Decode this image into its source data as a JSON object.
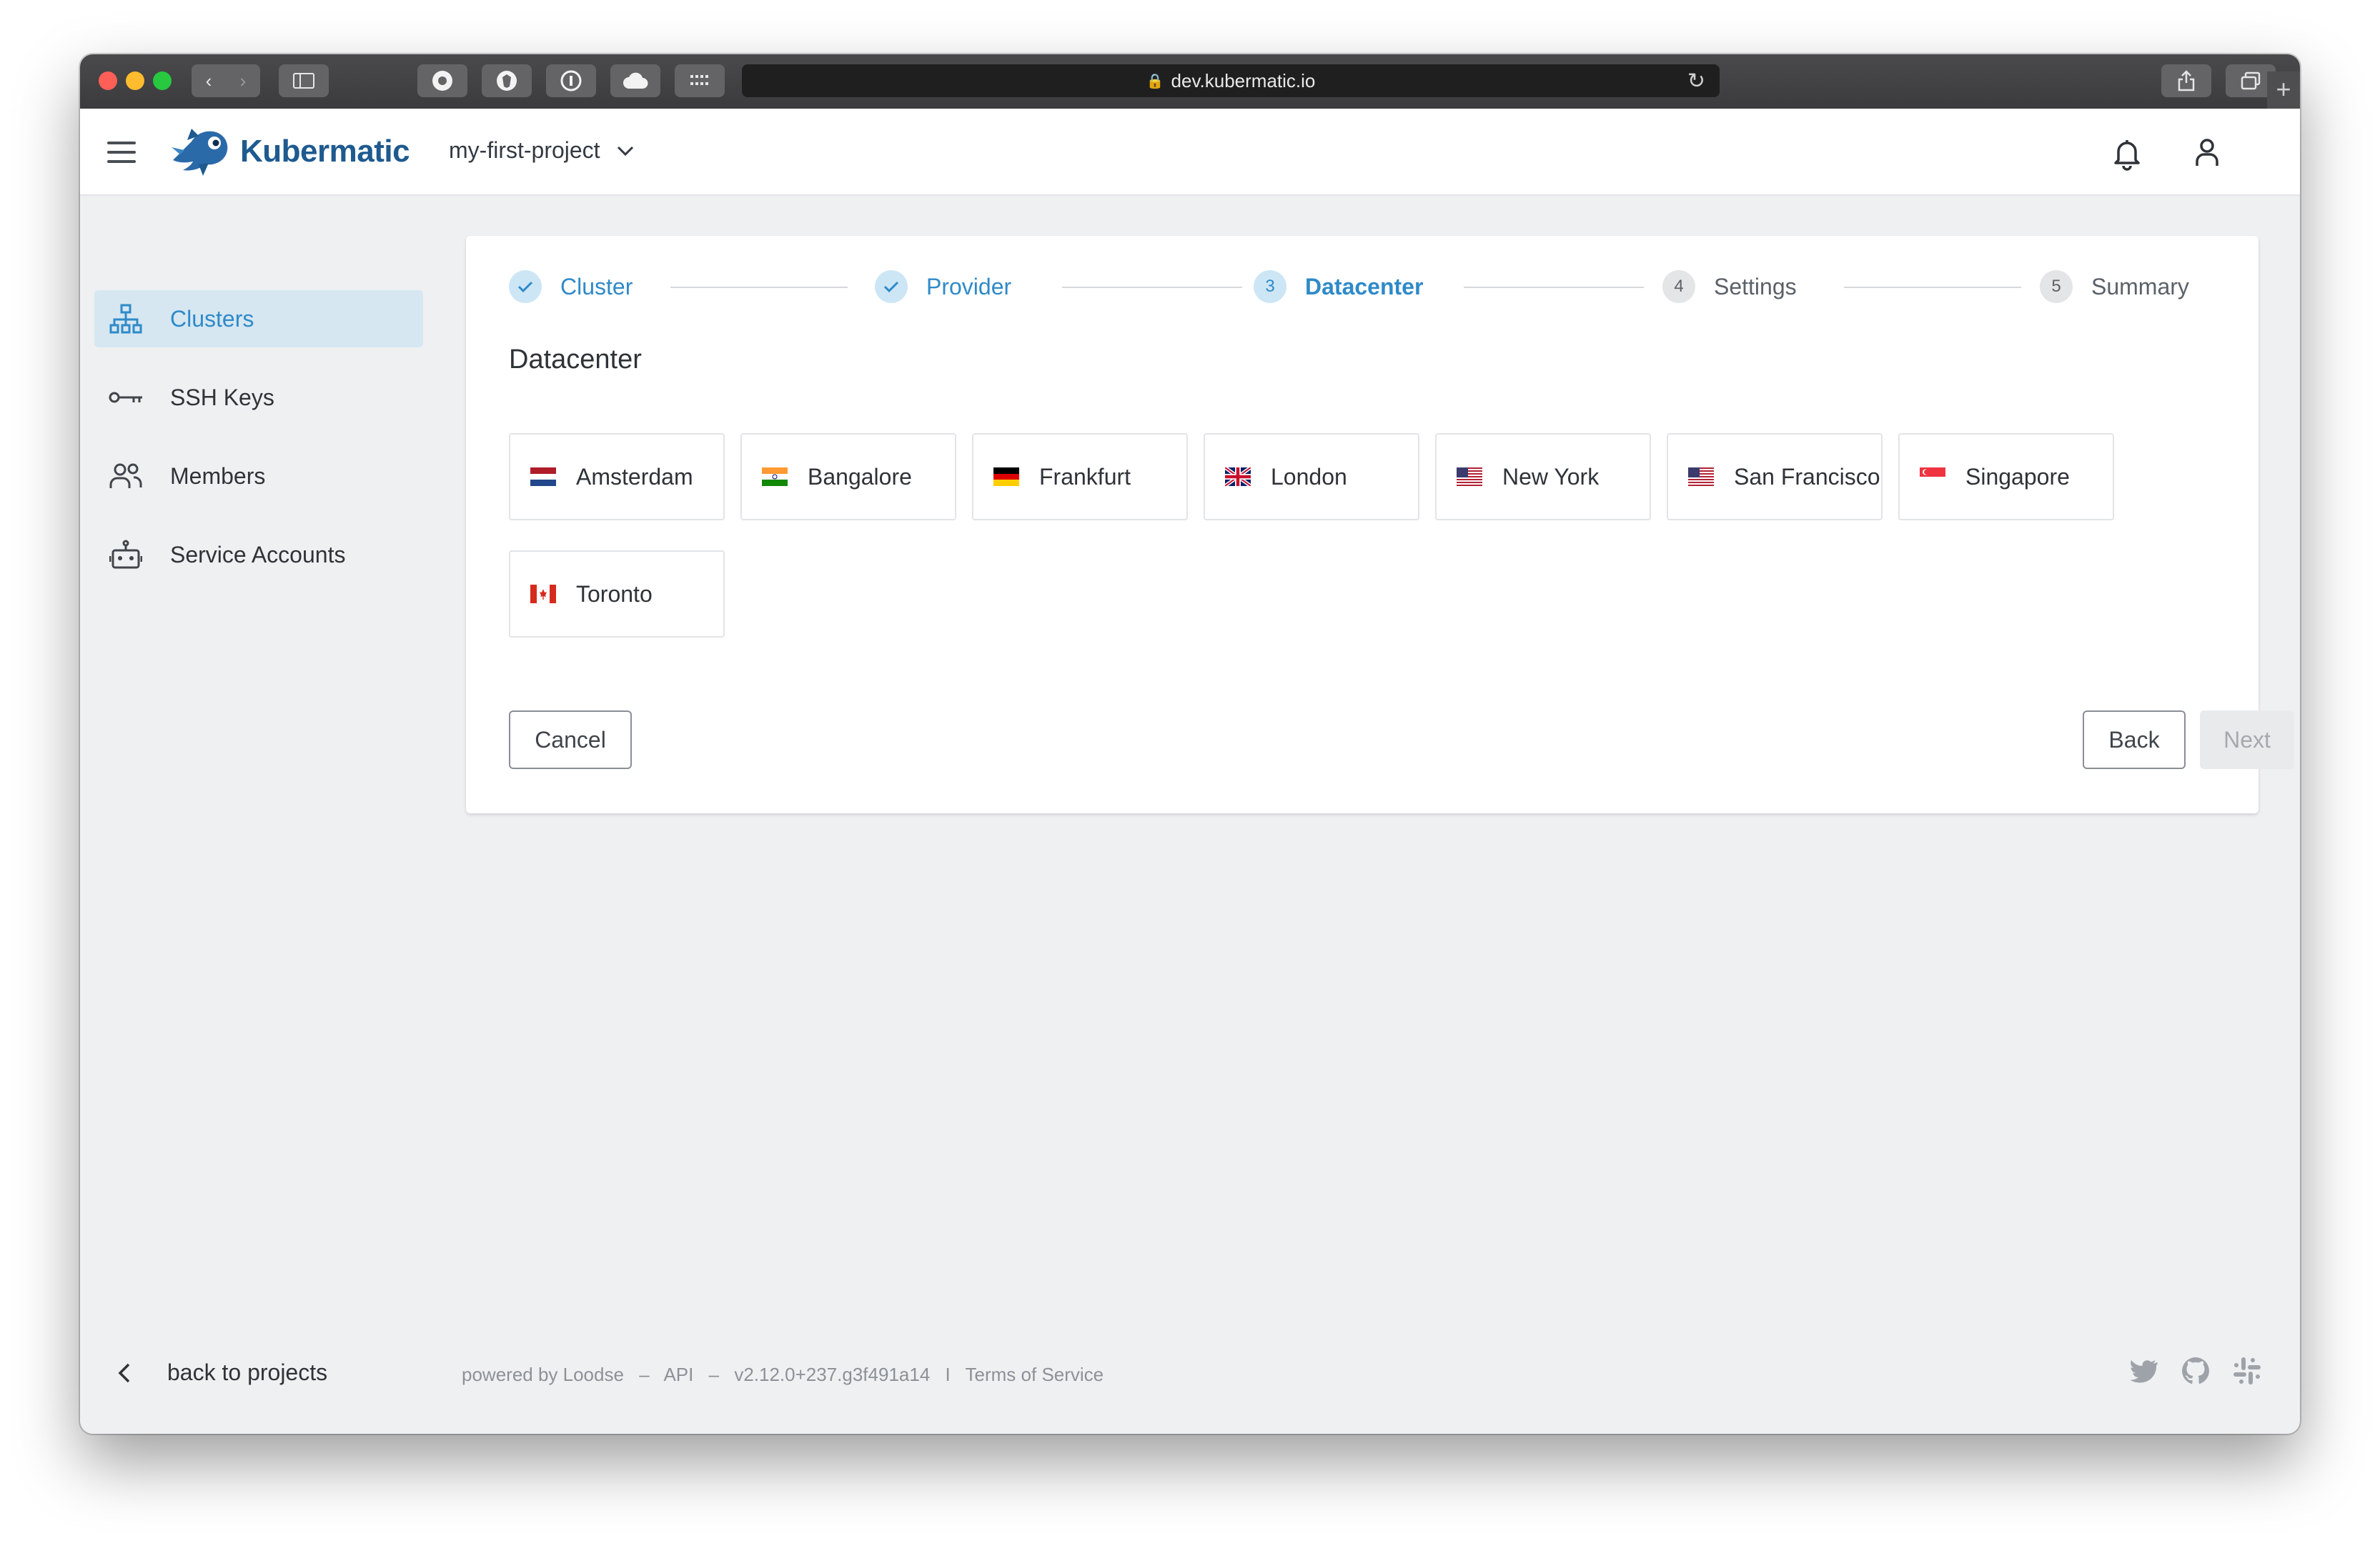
{
  "browser": {
    "url": "dev.kubermatic.io",
    "nav_back": "‹",
    "nav_forward": "›",
    "new_tab": "+"
  },
  "header": {
    "brand": "Kubermatic",
    "project": "my-first-project"
  },
  "sidebar": {
    "items": [
      {
        "label": "Clusters",
        "icon": "sitemap-icon",
        "active": true
      },
      {
        "label": "SSH Keys",
        "icon": "key-icon",
        "active": false
      },
      {
        "label": "Members",
        "icon": "members-icon",
        "active": false
      },
      {
        "label": "Service Accounts",
        "icon": "robot-icon",
        "active": false
      }
    ],
    "back_label": "back to projects"
  },
  "wizard": {
    "steps": [
      {
        "number": "1",
        "label": "Cluster",
        "state": "done"
      },
      {
        "number": "2",
        "label": "Provider",
        "state": "done"
      },
      {
        "number": "3",
        "label": "Datacenter",
        "state": "active"
      },
      {
        "number": "4",
        "label": "Settings",
        "state": "todo"
      },
      {
        "number": "5",
        "label": "Summary",
        "state": "todo"
      }
    ],
    "section_title": "Datacenter",
    "datacenters": [
      {
        "name": "Amsterdam",
        "flag": "nl"
      },
      {
        "name": "Bangalore",
        "flag": "in"
      },
      {
        "name": "Frankfurt",
        "flag": "de"
      },
      {
        "name": "London",
        "flag": "gb"
      },
      {
        "name": "New York",
        "flag": "us"
      },
      {
        "name": "San Francisco",
        "flag": "us"
      },
      {
        "name": "Singapore",
        "flag": "sg"
      },
      {
        "name": "Toronto",
        "flag": "ca"
      }
    ],
    "cancel_label": "Cancel",
    "back_label": "Back",
    "next_label": "Next"
  },
  "footer": {
    "powered_by": "powered by Loodse",
    "sep1": "–",
    "api": "API",
    "sep2": "–",
    "version": "v2.12.0+237.g3f491a14",
    "sep3": "I",
    "terms": "Terms of Service"
  },
  "colors": {
    "accent": "#2f8ac8",
    "brand": "#1e5a8f",
    "active_bg": "#d6e7f2"
  }
}
